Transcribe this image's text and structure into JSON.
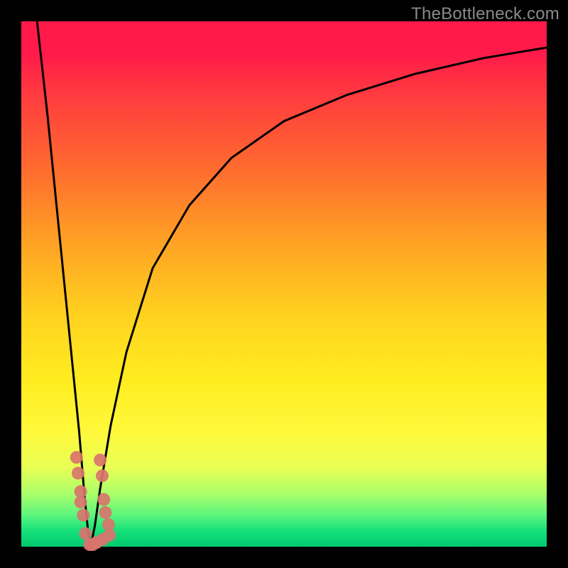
{
  "watermark": "TheBottleneck.com",
  "colors": {
    "frame": "#000000",
    "curve": "#000000",
    "dot": "#d9746e"
  },
  "chart_data": {
    "type": "line",
    "title": "",
    "xlabel": "",
    "ylabel": "",
    "xlim": [
      0,
      100
    ],
    "ylim": [
      0,
      100
    ],
    "grid": false,
    "legend": false,
    "note": "Two black curves forming a sharp V descending to ~0 near x≈13; right branch rises logarithmically toward ~95 at x=100. Values estimated from pixel positions on a 0–100 scale.",
    "series": [
      {
        "name": "left-branch",
        "x": [
          3,
          5,
          7,
          9,
          11,
          12,
          12.7,
          13.2
        ],
        "values": [
          100,
          82,
          62,
          42,
          22,
          10,
          3,
          0
        ]
      },
      {
        "name": "right-branch",
        "x": [
          13.2,
          14,
          15,
          17,
          20,
          25,
          32,
          40,
          50,
          62,
          75,
          88,
          100
        ],
        "values": [
          0,
          4,
          11,
          23,
          37,
          53,
          65,
          74,
          81,
          86,
          90,
          93,
          95
        ]
      }
    ],
    "scatter": {
      "name": "cluster-dots",
      "note": "Pink-red dots clustered near the bottom of the V, along both branches.",
      "points": [
        {
          "x": 10.5,
          "y": 17
        },
        {
          "x": 10.8,
          "y": 14
        },
        {
          "x": 11.3,
          "y": 10.5
        },
        {
          "x": 11.3,
          "y": 8.5
        },
        {
          "x": 11.8,
          "y": 6
        },
        {
          "x": 12.2,
          "y": 2.5
        },
        {
          "x": 13.0,
          "y": 0.4
        },
        {
          "x": 13.6,
          "y": 0.4
        },
        {
          "x": 14.3,
          "y": 0.8
        },
        {
          "x": 15.5,
          "y": 1.4
        },
        {
          "x": 16.8,
          "y": 2.2
        },
        {
          "x": 15.0,
          "y": 16.5
        },
        {
          "x": 15.4,
          "y": 13.5
        },
        {
          "x": 15.7,
          "y": 9
        },
        {
          "x": 16.0,
          "y": 6.5
        },
        {
          "x": 16.6,
          "y": 4.2
        }
      ]
    }
  }
}
